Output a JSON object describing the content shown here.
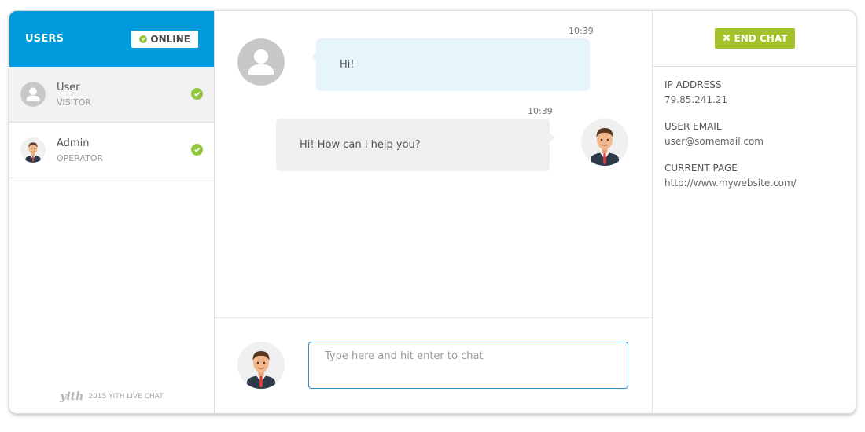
{
  "sidebar": {
    "title": "USERS",
    "status_label": "ONLINE",
    "users": [
      {
        "name": "User",
        "role": "VISITOR",
        "avatar": "visitor-avatar-icon"
      },
      {
        "name": "Admin",
        "role": "OPERATOR",
        "avatar": "operator-avatar-icon"
      }
    ],
    "footer_logo": "yith",
    "footer_text": "2015 YITH LIVE CHAT"
  },
  "chat": {
    "messages": [
      {
        "sender": "user",
        "time": "10:39",
        "text": "Hi!"
      },
      {
        "sender": "admin",
        "time": "10:39",
        "text": "Hi! How can I help you?"
      }
    ],
    "input_placeholder": "Type here and hit enter to chat"
  },
  "info_panel": {
    "end_chat_label": "END CHAT",
    "fields": [
      {
        "label": "IP ADDRESS",
        "value": "79.85.241.21"
      },
      {
        "label": "USER EMAIL",
        "value": "user@somemail.com"
      },
      {
        "label": "CURRENT PAGE",
        "value": "http://www.mywebsite.com/"
      }
    ]
  },
  "colors": {
    "header_blue": "#009bdb",
    "online_green": "#8fc63e",
    "end_chat_green": "#a3c22a",
    "user_bubble": "#e6f5fc",
    "admin_bubble": "#efefef"
  }
}
